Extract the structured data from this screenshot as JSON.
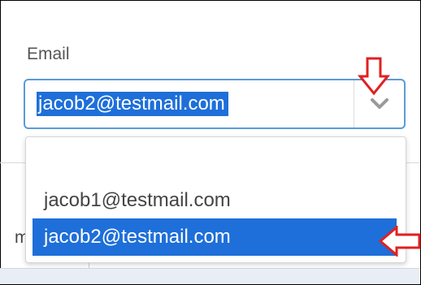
{
  "email_field": {
    "label": "Email",
    "selected_value": "jacob2@testmail.com"
  },
  "dropdown": {
    "options": [
      "",
      "jacob1@testmail.com",
      "jacob2@testmail.com"
    ],
    "highlighted_index": 2
  },
  "background": {
    "partial_text": "m"
  },
  "colors": {
    "accent_blue": "#1e6fd9",
    "focus_border": "#5b9bd5",
    "annotation_red": "#e02020"
  },
  "icons": {
    "dropdown_toggle": "chevron-down-icon",
    "annotation_down": "red-down-arrow",
    "annotation_left": "red-left-arrow"
  }
}
